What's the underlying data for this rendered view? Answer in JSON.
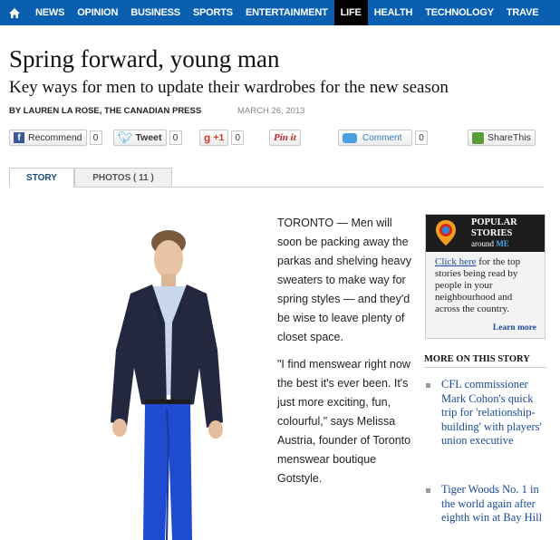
{
  "nav": {
    "items": [
      "NEWS",
      "OPINION",
      "BUSINESS",
      "SPORTS",
      "ENTERTAINMENT",
      "LIFE",
      "HEALTH",
      "TECHNOLOGY",
      "TRAVE"
    ],
    "active_index": 5
  },
  "article": {
    "title": "Spring forward, young man",
    "subtitle": "Key ways for men to update their wardrobes for the new season",
    "byline": "BY LAUREN LA ROSE, THE CANADIAN PRESS",
    "date": "MARCH 26, 2013",
    "paragraphs": [
      "TORONTO — Men will soon be packing away the parkas and shelving heavy sweaters to make way for spring styles — and they'd be wise to leave plenty of closet space.",
      "\"I find menswear right now the best it's ever been. It's just more exciting, fun, colourful,\" says Melissa Austria, founder of Toronto menswear boutique Gotstyle."
    ]
  },
  "social": {
    "recommend": {
      "label": "Recommend",
      "count": "0"
    },
    "tweet": {
      "label": "Tweet",
      "count": "0"
    },
    "gplus": {
      "label": "+1",
      "count": "0"
    },
    "pinit": {
      "label": "Pin it"
    },
    "comment": {
      "label": "Comment",
      "count": "0"
    },
    "share": {
      "label": "ShareThis"
    }
  },
  "tabs": {
    "story": "STORY",
    "photos": "PHOTOS ( 11 )"
  },
  "popular": {
    "title_line1": "POPULAR",
    "title_line2": "STORIES",
    "around": "around",
    "me": "ME",
    "link": "Click here",
    "body": " for the top stories being read by people in your neighbourhood and across the country.",
    "learn_more": "Learn more"
  },
  "more_on_story": {
    "heading": "MORE ON THIS STORY",
    "items": [
      "CFL commissioner Mark Cohon's quick trip for 'relationship-building' with players' union executive",
      "Tiger Woods No. 1 in the world again after eighth win at Bay Hill"
    ]
  },
  "colors": {
    "nav_blue": "#0a5fb0",
    "link_blue": "#1a4a9a",
    "blazer_navy": "#23283f",
    "pants_blue": "#1f4bd0"
  },
  "icons": [
    "home-icon",
    "facebook-icon",
    "twitter-icon",
    "google-plus-icon",
    "pinterest-icon",
    "comment-icon",
    "sharethis-icon",
    "location-pin-icon"
  ]
}
